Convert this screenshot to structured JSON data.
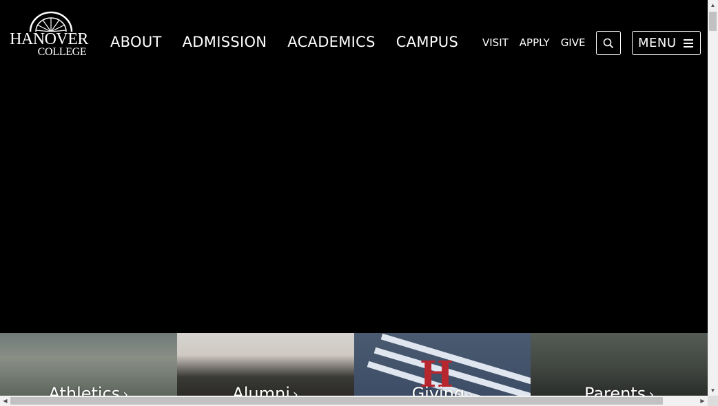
{
  "logo": {
    "line1": "HANOVER",
    "line2": "COLLEGE"
  },
  "nav": {
    "main": [
      "ABOUT",
      "ADMISSION",
      "ACADEMICS",
      "CAMPUS"
    ],
    "utility": [
      "VISIT",
      "APPLY",
      "GIVE"
    ]
  },
  "menu_button": {
    "label": "MENU"
  },
  "tiles": [
    {
      "label": "Athletics"
    },
    {
      "label": "Alumni"
    },
    {
      "label": "Giving"
    },
    {
      "label": "Parents"
    }
  ],
  "colors": {
    "background": "#000000",
    "text": "#ffffff"
  }
}
